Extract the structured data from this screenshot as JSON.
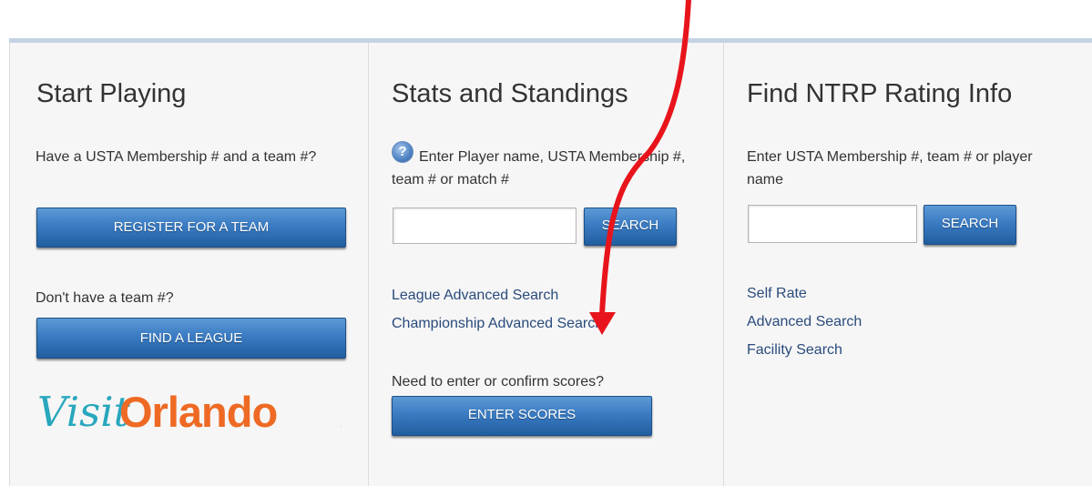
{
  "columns": {
    "start_playing": {
      "title": "Start Playing",
      "have_membership_text": "Have a USTA Membership # and a team #?",
      "register_button": "REGISTER FOR A TEAM",
      "no_team_text": "Don't have a team #?",
      "find_league_button": "FIND A LEAGUE",
      "logo": {
        "visit": "Visit",
        "orlando": "Orlando",
        "mark": "."
      }
    },
    "stats_standings": {
      "title": "Stats and Standings",
      "help_icon_glyph": "?",
      "instructions": "Enter Player name, USTA Membership #, team # or match #",
      "search_input": {
        "value": "",
        "placeholder": ""
      },
      "search_button": "SEARCH",
      "links": [
        "League Advanced Search",
        "Championship Advanced Search"
      ],
      "scores_prompt": "Need to enter or confirm scores?",
      "enter_scores_button": "ENTER SCORES"
    },
    "ntrp": {
      "title": "Find NTRP Rating Info",
      "instructions": "Enter USTA Membership #, team # or player name",
      "search_input": {
        "value": "",
        "placeholder": ""
      },
      "search_button": "SEARCH",
      "links": [
        "Self Rate",
        "Advanced Search",
        "Facility Search"
      ]
    }
  },
  "colors": {
    "button_gradient_top": "#5c9ad6",
    "button_gradient_bottom": "#215e9f",
    "link": "#2a4b7c",
    "annotation_arrow": "#e8141c",
    "logo_visit": "#28a7bd",
    "logo_orlando": "#ee6a24"
  },
  "annotation": {
    "type": "red-arrow",
    "points_to": "ENTER SCORES"
  }
}
